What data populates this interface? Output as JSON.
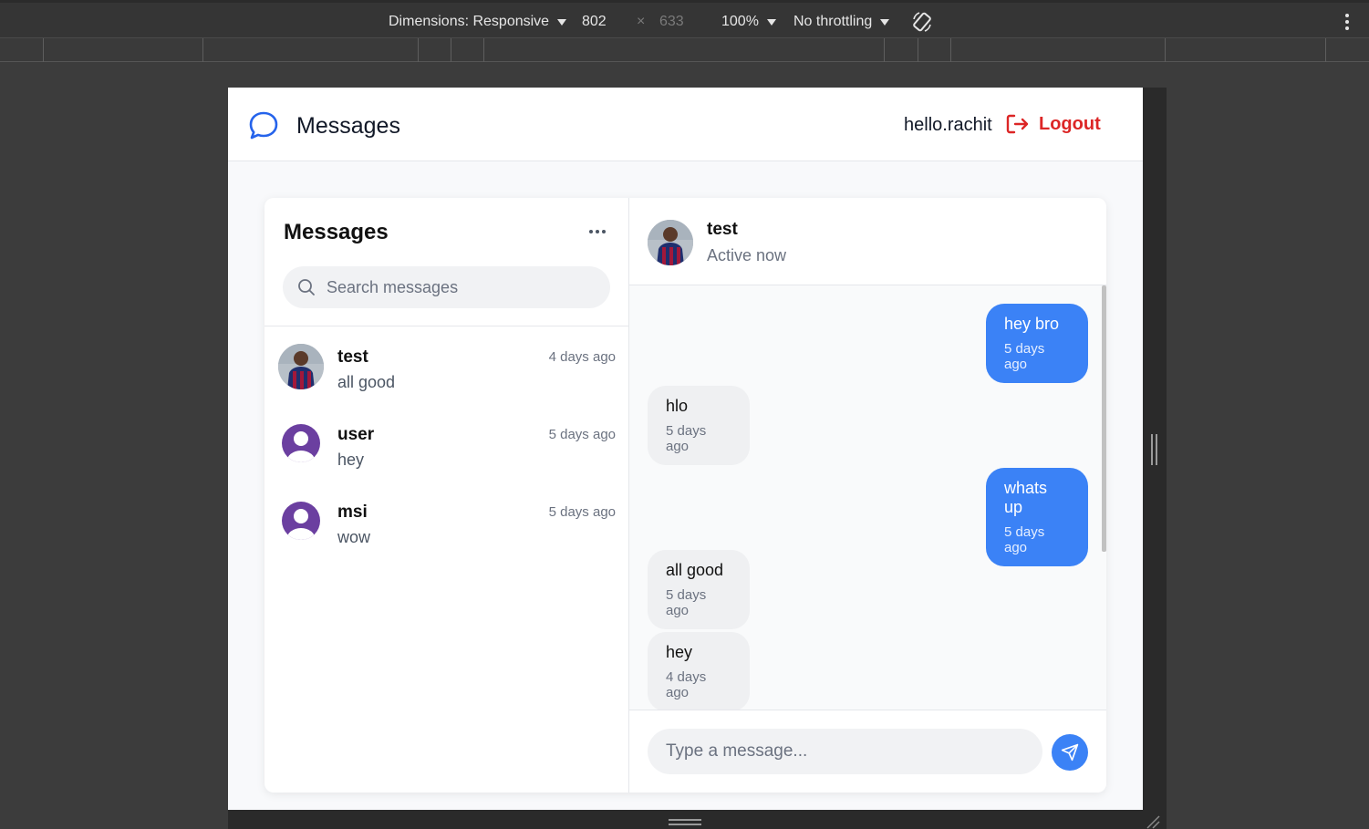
{
  "devtools": {
    "dimensions_label": "Dimensions: Responsive",
    "width_value": "802",
    "times": "×",
    "height_value": "633",
    "zoom": "100%",
    "throttling": "No throttling"
  },
  "app": {
    "title": "Messages",
    "username": "hello.rachit",
    "logout_label": "Logout",
    "accent_color": "#3b82f6",
    "logout_color": "#dc2626"
  },
  "sidebar": {
    "title": "Messages",
    "search_placeholder": "Search messages",
    "conversations": [
      {
        "name": "test",
        "preview": "all good",
        "time": "4 days ago",
        "avatar": "photo"
      },
      {
        "name": "user",
        "preview": "hey",
        "time": "5 days ago",
        "avatar": "default-user-icon"
      },
      {
        "name": "msi",
        "preview": "wow",
        "time": "5 days ago",
        "avatar": "default-user-icon"
      }
    ]
  },
  "chat": {
    "contact_name": "test",
    "status": "Active now",
    "messages": [
      {
        "text": "hey bro",
        "time": "5 days ago",
        "direction": "outgoing"
      },
      {
        "text": "hlo",
        "time": "5 days ago",
        "direction": "incoming"
      },
      {
        "text": "whats up",
        "time": "5 days ago",
        "direction": "outgoing"
      },
      {
        "text": "all good",
        "time": "5 days ago",
        "direction": "incoming"
      },
      {
        "text": "hey",
        "time": "4 days ago",
        "direction": "incoming"
      }
    ],
    "input_placeholder": "Type a message..."
  }
}
